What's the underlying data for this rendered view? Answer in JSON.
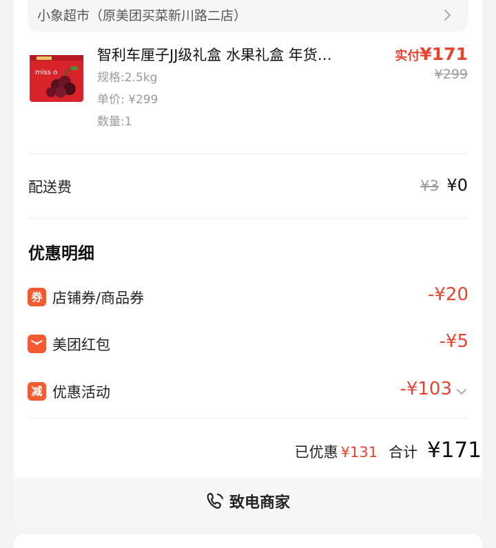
{
  "store": {
    "name": "小象超市（原美团买菜新川路二店）"
  },
  "product": {
    "title": "智利车厘子JJ级礼盒 水果礼盒 年货…",
    "spec": "规格:2.5kg",
    "unit_price": "单价: ¥299",
    "quantity": "数量:1",
    "paid_label": "实付",
    "paid_amount": "¥171",
    "original_price": "¥299",
    "thumb_text": "miss o"
  },
  "delivery": {
    "label": "配送费",
    "original": "¥3",
    "value": "¥0"
  },
  "discounts": {
    "title": "优惠明细",
    "items": [
      {
        "badge": "券",
        "label": "店铺券/商品券",
        "value": "-¥20"
      },
      {
        "badge": "",
        "label": "美团红包",
        "value": "-¥5"
      },
      {
        "badge": "减",
        "label": "优惠活动",
        "value": "-¥103"
      }
    ]
  },
  "totals": {
    "saved_label": "已优惠",
    "saved_amount": "¥131",
    "sum_label": "合计",
    "sum_amount": "¥171"
  },
  "contact": {
    "label": "致电商家"
  },
  "colors": {
    "accent": "#e8432f",
    "badge": "#f35a32"
  }
}
